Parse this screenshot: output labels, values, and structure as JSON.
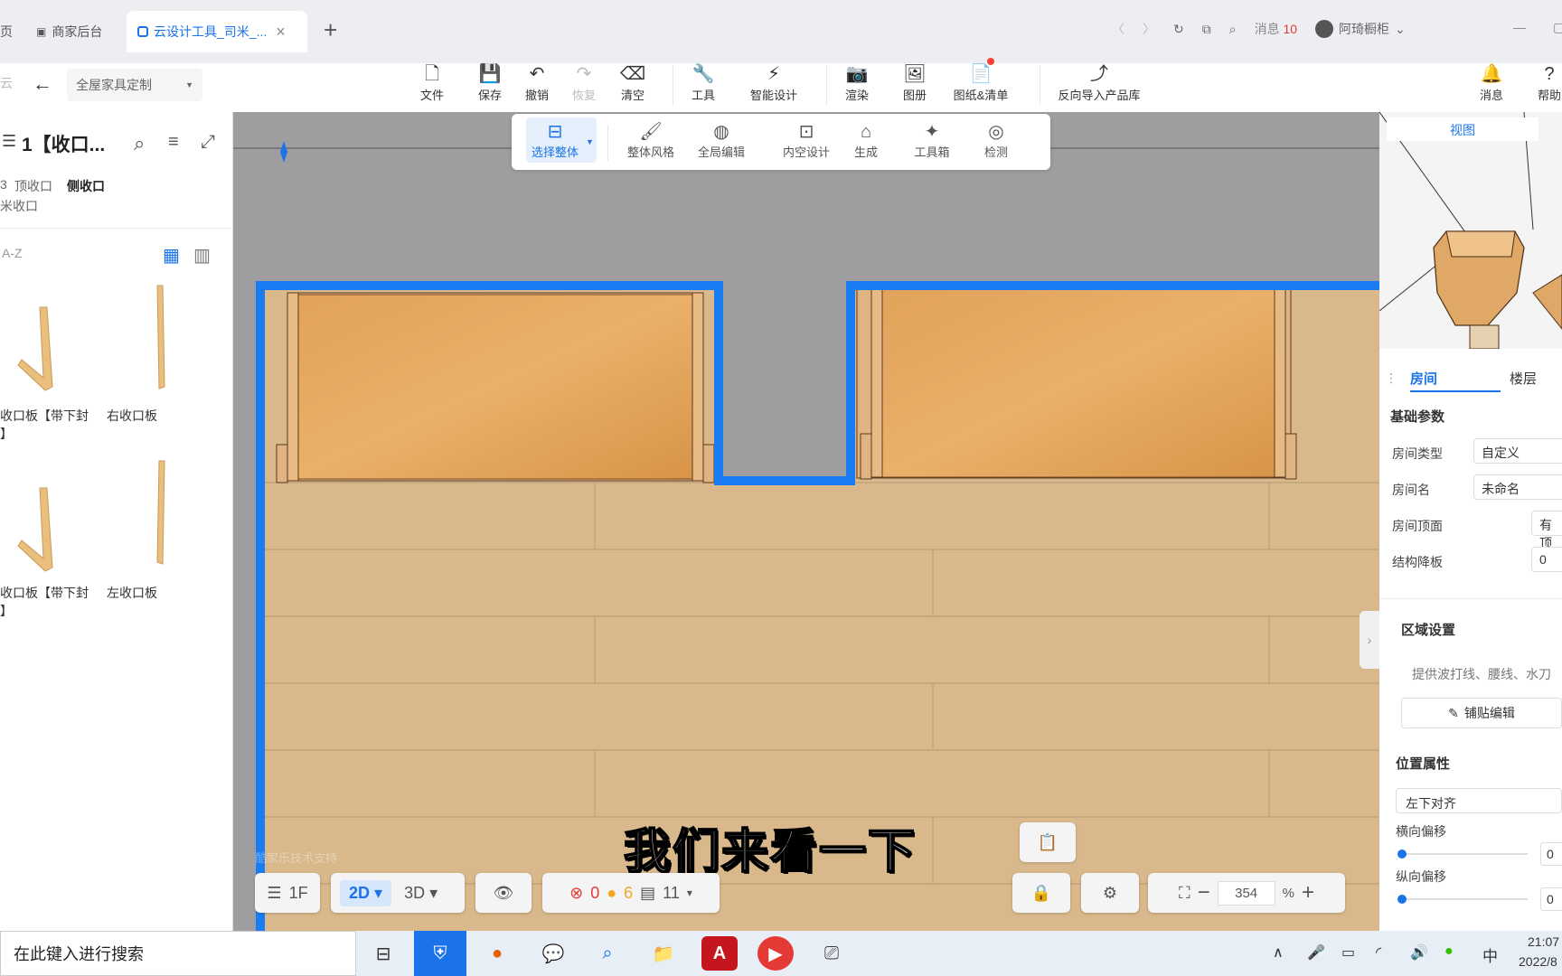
{
  "browser": {
    "tabs": [
      {
        "label": "页"
      },
      {
        "label": "商家后台"
      },
      {
        "label": "云设计工具_司米_..."
      }
    ],
    "new_tab": "+",
    "messages_label": "消息",
    "messages_count": "10",
    "user_name": "阿琦橱柜"
  },
  "header": {
    "back_left": "云",
    "category": "全屋家具定制",
    "tools": [
      {
        "label": "文件",
        "icon": "file-icon"
      },
      {
        "label": "保存",
        "icon": "save-icon"
      },
      {
        "label": "撤销",
        "icon": "undo-icon"
      },
      {
        "label": "恢复",
        "icon": "redo-icon"
      },
      {
        "label": "清空",
        "icon": "eraser-icon"
      },
      {
        "label": "工具",
        "icon": "wrench-icon"
      },
      {
        "label": "智能设计",
        "icon": "smart-design-icon"
      },
      {
        "label": "渲染",
        "icon": "camera-icon"
      },
      {
        "label": "图册",
        "icon": "album-icon"
      },
      {
        "label": "图纸&清单",
        "icon": "drawing-icon"
      },
      {
        "label": "反向导入产品库",
        "icon": "import-icon"
      }
    ],
    "right_tools": [
      {
        "label": "消息",
        "icon": "bell-icon"
      },
      {
        "label": "帮助",
        "icon": "help-icon"
      }
    ]
  },
  "subtoolbar": [
    {
      "label": "选择整体",
      "icon": "select-all-icon"
    },
    {
      "label": "整体风格",
      "icon": "style-icon"
    },
    {
      "label": "全局编辑",
      "icon": "global-edit-icon"
    },
    {
      "label": "内空设计",
      "icon": "interior-design-icon"
    },
    {
      "label": "生成",
      "icon": "generate-icon"
    },
    {
      "label": "工具箱",
      "icon": "toolbox-icon"
    },
    {
      "label": "检测",
      "icon": "detect-icon"
    }
  ],
  "left_panel": {
    "title": "1【收口...",
    "filters": [
      "顶收口",
      "侧收口"
    ],
    "filter_prefix": "3",
    "filter_second_line": "米收口",
    "sort_label": "A-Z",
    "items": [
      {
        "label": "收口板【带下封",
        "sub": "】"
      },
      {
        "label": "右收口板",
        "sub": ""
      },
      {
        "label": "收口板【带下封",
        "sub": "】"
      },
      {
        "label": "左收口板",
        "sub": ""
      }
    ]
  },
  "canvas": {
    "watermark": "酷家乐技术支持",
    "subtitle": "我们来看一下"
  },
  "right_panel": {
    "view_tab": "视图",
    "tabs": [
      "房间",
      "楼层"
    ],
    "basic_params": "基础参数",
    "fields": [
      {
        "label": "房间类型",
        "value": "自定义"
      },
      {
        "label": "房间名",
        "value": "未命名"
      },
      {
        "label": "房间顶面",
        "value": "有顶"
      },
      {
        "label": "结构降板",
        "value": "0"
      }
    ],
    "region_title": "区域设置",
    "region_desc": "提供波打线、腰线、水刀",
    "paste_edit": "铺贴编辑",
    "position_title": "位置属性",
    "align_value": "左下对齐",
    "h_offset_label": "横向偏移",
    "h_offset_value": "0",
    "v_offset_label": "纵向偏移",
    "v_offset_value": "0"
  },
  "bottom_bar": {
    "floor": "1F",
    "mode_2d": "2D",
    "mode_3d": "3D",
    "errors": "0",
    "warnings": "6",
    "items": "11",
    "zoom": "354",
    "zoom_unit": "%"
  },
  "taskbar": {
    "search_placeholder": "在此键入进行搜索",
    "time": "21:07",
    "date": "2022/8",
    "ime": "中"
  }
}
